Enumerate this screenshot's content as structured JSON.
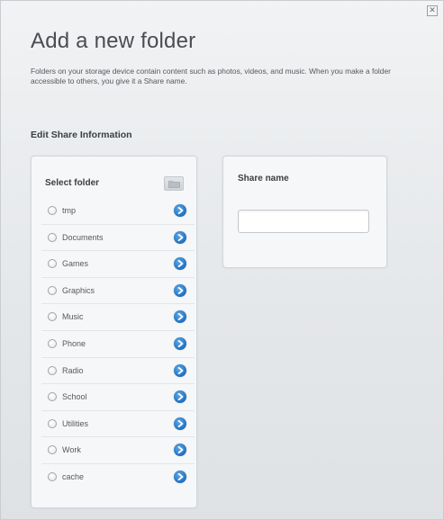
{
  "dialog": {
    "close_label": "✕",
    "title": "Add a new folder",
    "description": "Folders on your storage device contain content such as photos, videos, and music. When you make a folder accessible to others, you give it a Share name.",
    "section_title": "Edit Share Information"
  },
  "folder_panel": {
    "title": "Select folder",
    "new_folder_icon": "folder-add-icon",
    "folders": [
      {
        "label": "tmp",
        "selected": false
      },
      {
        "label": "Documents",
        "selected": false
      },
      {
        "label": "Games",
        "selected": false
      },
      {
        "label": "Graphics",
        "selected": false
      },
      {
        "label": "Music",
        "selected": false
      },
      {
        "label": "Phone",
        "selected": false
      },
      {
        "label": "Radio",
        "selected": false
      },
      {
        "label": "School",
        "selected": false
      },
      {
        "label": "Utilities",
        "selected": false
      },
      {
        "label": "Work",
        "selected": false
      },
      {
        "label": "cache",
        "selected": false
      }
    ],
    "expand_icon": "chevron-right-circle-icon",
    "accent_color": "#1f6fc0"
  },
  "share_panel": {
    "title": "Share name",
    "input_value": "",
    "input_placeholder": ""
  }
}
